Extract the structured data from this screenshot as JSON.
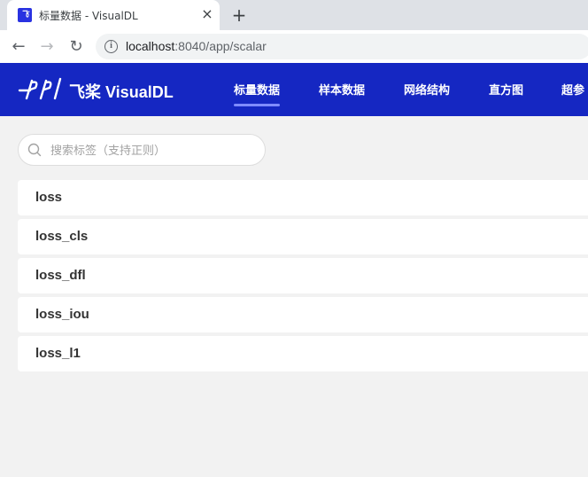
{
  "browser": {
    "tab_title": "标量数据 - VisualDL",
    "tab_favicon_text": "飞",
    "close_icon": "×",
    "new_tab_icon": "+",
    "back_icon": "←",
    "forward_icon": "→",
    "reload_icon": "↻",
    "info_icon": "i",
    "url_host": "localhost",
    "url_rest": ":8040/app/scalar"
  },
  "header": {
    "brand": "飞桨 VisualDL",
    "nav": [
      {
        "label": "标量数据",
        "active": true
      },
      {
        "label": "样本数据",
        "active": false
      },
      {
        "label": "网络结构",
        "active": false
      },
      {
        "label": "直方图",
        "active": false
      },
      {
        "label": "超参",
        "active": false
      }
    ],
    "background": "#1527c2"
  },
  "search": {
    "placeholder": "搜索标签（支持正则）"
  },
  "tags": [
    {
      "label": "loss"
    },
    {
      "label": "loss_cls"
    },
    {
      "label": "loss_dfl"
    },
    {
      "label": "loss_iou"
    },
    {
      "label": "loss_l1"
    }
  ]
}
